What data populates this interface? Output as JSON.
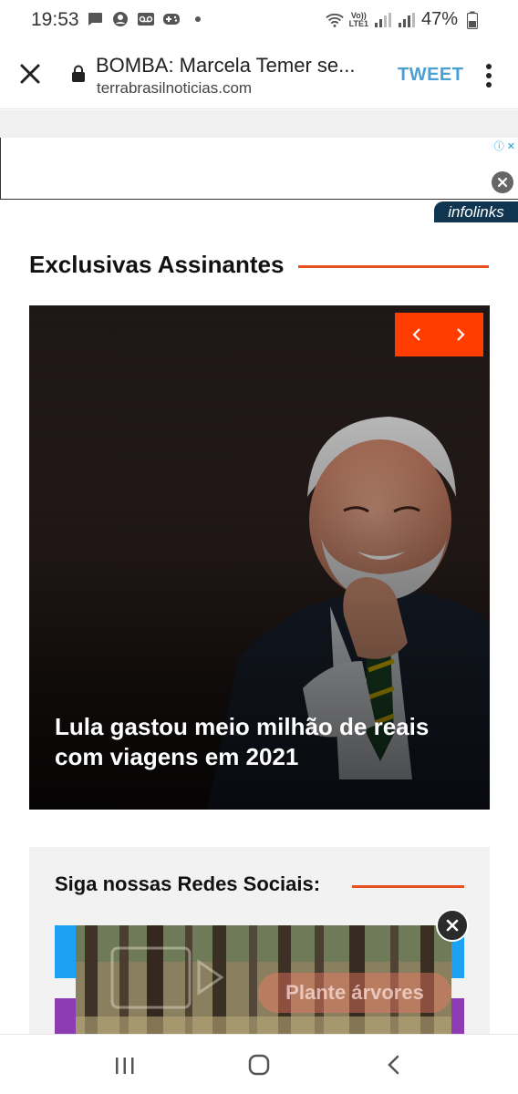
{
  "status_bar": {
    "time": "19:53",
    "battery_percent": "47%",
    "network_label_top": "Vo))",
    "network_label_bottom": "LTE1"
  },
  "toolbar": {
    "page_title": "BOMBA: Marcela Temer se...",
    "url": "terrabrasilnoticias.com",
    "tweet_label": "TWEET"
  },
  "ad": {
    "info_label": "ⓘ ✕",
    "provider_badge": "infolinks"
  },
  "section": {
    "title": "Exclusivas Assinantes"
  },
  "feature": {
    "headline": "Lula gastou meio milhão de reais com viagens em 2021"
  },
  "social": {
    "title": "Siga nossas Redes Sociais:"
  },
  "video_ad": {
    "overlay_text": "Plante árvores"
  },
  "colors": {
    "accent": "#e8501e",
    "slider_nav": "#ff3d00",
    "tweet": "#4a9fd5",
    "twitter_blue": "#1da1f2",
    "purple": "#8e3cb3"
  }
}
